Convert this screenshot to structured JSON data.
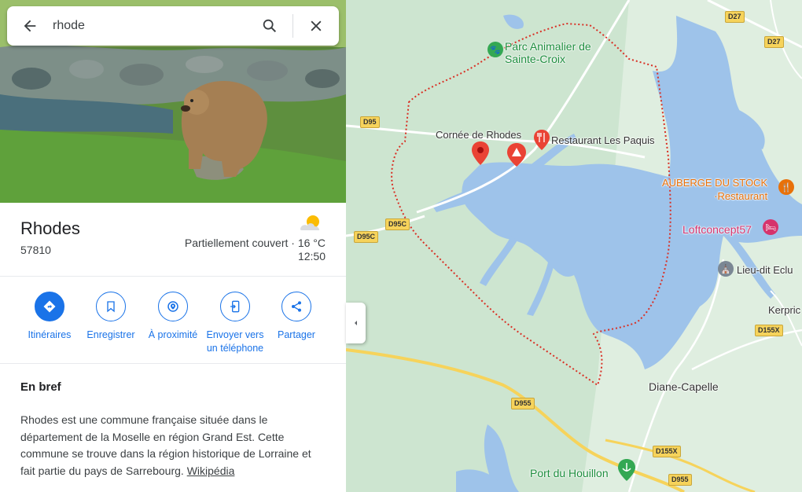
{
  "search": {
    "query": "rhode",
    "back_icon": "arrow-left-icon",
    "search_icon": "search-icon",
    "close_icon": "close-icon"
  },
  "place": {
    "title": "Rhodes",
    "postcode": "57810",
    "weather": {
      "icon": "partly-cloudy-icon",
      "condition": "Partiellement couvert · 16 °C",
      "time": "12:50"
    }
  },
  "actions": [
    {
      "label": "Itinéraires",
      "icon": "directions-icon"
    },
    {
      "label": "Enregistrer",
      "icon": "bookmark-icon"
    },
    {
      "label": "À proximité",
      "icon": "nearby-icon"
    },
    {
      "label": "Envoyer vers un téléphone",
      "icon": "send-to-phone-icon"
    },
    {
      "label": "Partager",
      "icon": "share-icon"
    }
  ],
  "brief": {
    "heading": "En bref",
    "text": "Rhodes est une commune française située dans le département de la Moselle en région Grand Est. Cette commune se trouve dans la région historique de Lorraine et fait partie du pays de Sarrebourg.",
    "link": "Wikipédia"
  },
  "map": {
    "places": {
      "parc": "Parc Animalier de Sainte-Croix",
      "cornee": "Cornée de Rhodes",
      "restaurant": "Restaurant Les Paquis",
      "auberge_name": "AUBERGE DU STOCK",
      "auberge_type": "Restaurant",
      "loftconcept": "Loftconcept57",
      "lieu_dit": "Lieu-dit Eclu",
      "kerprich": "Kerpric",
      "diane": "Diane-Capelle",
      "port": "Port du Houillon"
    },
    "roads": [
      "D27",
      "D27",
      "D95",
      "D95C",
      "D95C",
      "D955",
      "D155X",
      "D155X",
      "D955"
    ],
    "colors": {
      "water": "#9ec3ea",
      "land": "#cfe6d2",
      "boundary": "#d93025",
      "road": "#ffffff",
      "major_road": "#f6d35b"
    }
  },
  "ui": {
    "collapse_icon": "chevron-left-icon"
  }
}
